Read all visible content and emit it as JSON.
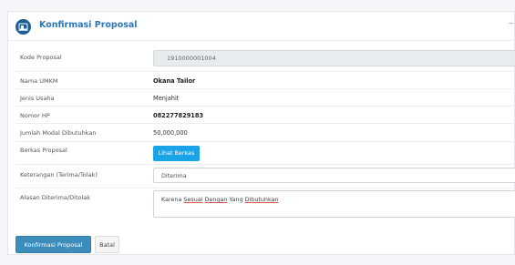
{
  "header": {
    "title": "Konfirmasi Proposal",
    "collapse_symbol": "−",
    "logo_icon": "tailor-shop-icon"
  },
  "form": {
    "kode_proposal": {
      "label": "Kode Proposal",
      "value": "1910000001004"
    },
    "nama_umkm": {
      "label": "Nama UMKM",
      "value": "Okana Tailor"
    },
    "jenis_usaha": {
      "label": "Jenis Usaha",
      "value": "Menjahit"
    },
    "nomor_hp": {
      "label": "Nomor HP",
      "value": "082277829183"
    },
    "jumlah_modal": {
      "label": "Jumlah Modal Dibutuhkan",
      "value": "50,000,000"
    },
    "berkas": {
      "label": "Berkas Proposal",
      "button_label": "Lihat Berkas"
    },
    "keterangan": {
      "label": "Keterangan (Terima/Tolak)",
      "selected": "Diterima"
    },
    "alasan": {
      "label": "Alasan Diterima/Ditolak",
      "value_parts": [
        "Karena ",
        "Sesuai",
        " ",
        "Dengan",
        " Yang ",
        "Dibutuhkan"
      ]
    }
  },
  "footer": {
    "submit_label": "Konfirmasi Proposal",
    "cancel_label": "Batal"
  },
  "colors": {
    "primary": "#3c8dbc",
    "info": "#1aa3e6",
    "title": "#2b77b5",
    "logo_bg": "#1f5f93"
  }
}
